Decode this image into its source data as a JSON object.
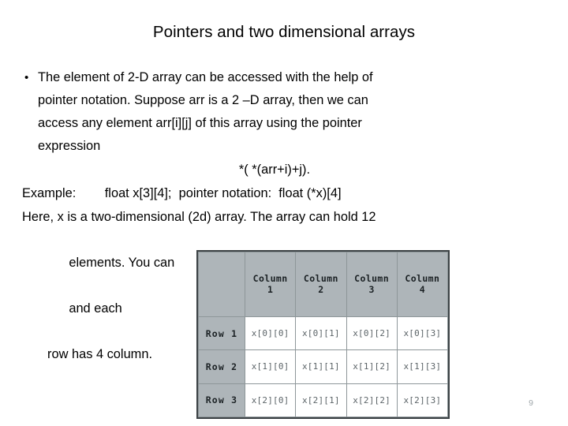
{
  "slide": {
    "title": "Pointers and two dimensional arrays",
    "page_number": "9"
  },
  "content": {
    "bullet_marker": "•",
    "bullet_paragraph_line1": "The element of  2-D array can be accessed with the help of",
    "bullet_paragraph_line2": "pointer notation. Suppose arr is a 2 –D array, then we can",
    "bullet_paragraph_line3": "access any element arr[i][j] of this array using the pointer",
    "bullet_paragraph_line4": "expression",
    "formula": "*( *(arr+i)+j).",
    "example_line": "Example:        float x[3][4];  pointer notation:  float (*x)[4]",
    "here_line": "Here, x is a two-dimensional (2d) array. The array can hold 12",
    "wrapped_line_left": "elements. You can",
    "wrapped_line_right": "and each",
    "wrapped_line_last": "row has 4 column."
  },
  "array_table": {
    "corner_label": "",
    "column_headers": [
      {
        "label": "Column",
        "number": "1"
      },
      {
        "label": "Column",
        "number": "2"
      },
      {
        "label": "Column",
        "number": "3"
      },
      {
        "label": "Column",
        "number": "4"
      }
    ],
    "rows": [
      {
        "header": "Row 1",
        "cells": [
          "x[0][0]",
          "x[0][1]",
          "x[0][2]",
          "x[0][3]"
        ]
      },
      {
        "header": "Row 2",
        "cells": [
          "x[1][0]",
          "x[1][1]",
          "x[1][2]",
          "x[1][3]"
        ]
      },
      {
        "header": "Row 3",
        "cells": [
          "x[2][0]",
          "x[2][1]",
          "x[2][2]",
          "x[2][3]"
        ]
      }
    ]
  },
  "colors": {
    "header_gray": "#aeb5b9",
    "table_border": "#3c4245",
    "cell_border": "#8e9699",
    "cell_text": "#5c6468",
    "header_text": "#1b2124",
    "page_number": "#9fa6aa",
    "body_text": "#000000"
  }
}
